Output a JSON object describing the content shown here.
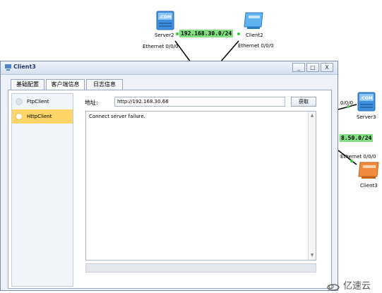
{
  "topology": {
    "net_label_1": "192.168.30.0/24",
    "net_label_2": "8.50.0/24",
    "server2_label": "Server2",
    "client2_label": "Client2",
    "server3_label": "Server3",
    "client3_label": "Client3",
    "iface_left": "Ethernet 0/0/0",
    "iface_right": "Ethernet 0/0/0",
    "iface_server3": "0/0/0",
    "iface_client3": "Ethernet 0/0/0",
    "com_badge": ".COM",
    "accent_link_color": "#7ee07e",
    "server_color": "#3f8fe0",
    "client3_color": "#f08a3c"
  },
  "window": {
    "title": "Client3",
    "minimize": "_",
    "maximize": "□",
    "close": "X",
    "tabs": [
      {
        "label": "基础配置",
        "active": false
      },
      {
        "label": "客户端信息",
        "active": true
      },
      {
        "label": "日志信息",
        "active": false
      }
    ],
    "clients": [
      {
        "label": "FtpClient",
        "selected": false
      },
      {
        "label": "HttpClient",
        "selected": true
      }
    ],
    "address_label": "地址:",
    "address_value": "http://192.168.30.66",
    "fetch_button": "获取",
    "response_text": "Connect server failure.",
    "scroll_up": "▲",
    "scroll_down": "▼"
  },
  "watermark": "亿速云"
}
